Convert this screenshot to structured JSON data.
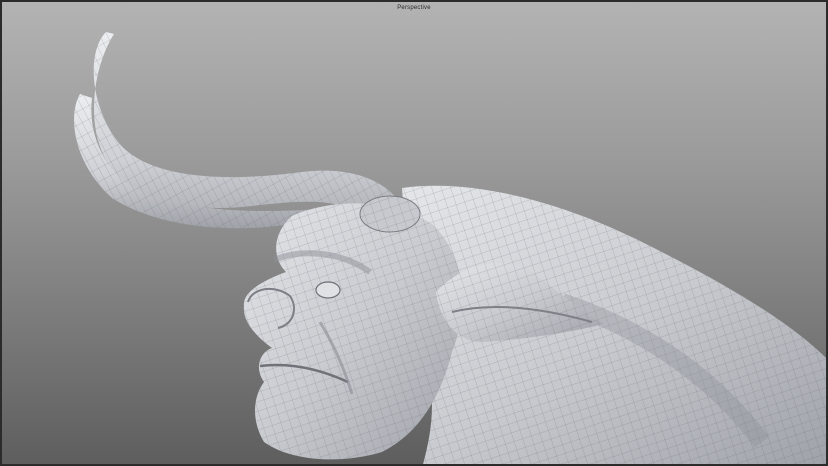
{
  "viewport": {
    "label": "Perspective",
    "model_icon": "horned-creature-mesh",
    "colors": {
      "bg_top": "#b3b3b3",
      "bg_bottom": "#5e5e5e",
      "mesh_base": "#d2d4d8",
      "wire": "#5a5c62"
    }
  }
}
